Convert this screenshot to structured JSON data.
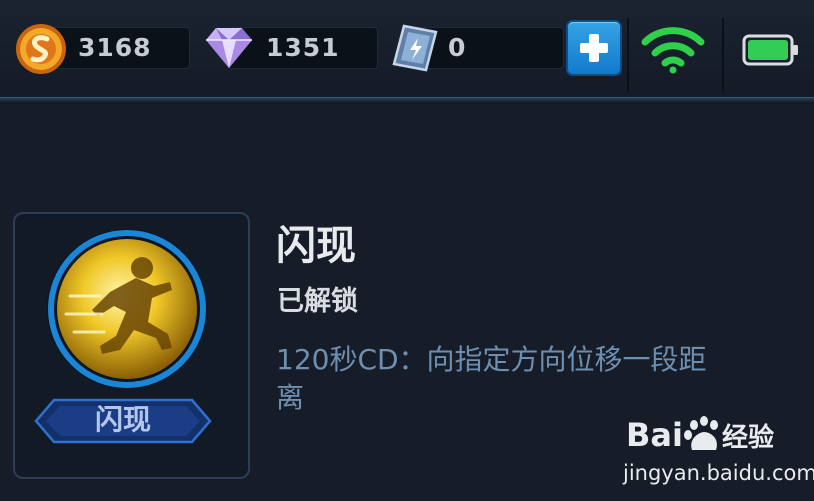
{
  "resources": {
    "gold": {
      "icon": "gold-coin-icon",
      "value": "3168"
    },
    "diamond": {
      "icon": "purple-diamond-icon",
      "value": "1351"
    },
    "voucher": {
      "icon": "voucher-card-icon",
      "value": "0"
    },
    "add_icon": "plus-icon"
  },
  "status": {
    "wifi_icon": "wifi-icon",
    "wifi_color": "#2fd04a",
    "battery_icon": "battery-icon",
    "battery_color": "#33cc55"
  },
  "skill": {
    "icon": "sprinting-figure-icon",
    "badge_label": "闪现",
    "name": "闪现",
    "status": "已解锁",
    "description": "120秒CD：向指定方向位移一段距离"
  },
  "watermark": {
    "logo": "Baidu经验",
    "url": "jingyan.baidu.com"
  },
  "colors": {
    "background": "#161c28",
    "accent_blue": "#1a86d6",
    "gold": "#e8b21f",
    "description_text": "#6e8faf"
  }
}
